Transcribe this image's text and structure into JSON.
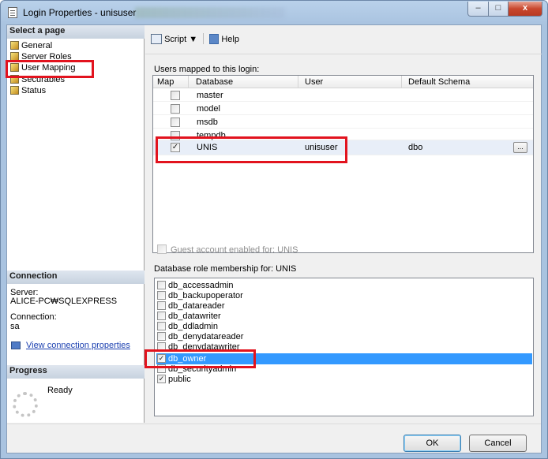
{
  "window": {
    "title": "Login Properties - unisuser"
  },
  "left": {
    "select_page_header": "Select a page",
    "pages": [
      "General",
      "Server Roles",
      "User Mapping",
      "Securables",
      "Status"
    ],
    "connection_header": "Connection",
    "server_label": "Server:",
    "server_value": "ALICE-PC₩SQLEXPRESS",
    "connection_label": "Connection:",
    "connection_value": "sa",
    "view_connection_link": "View connection properties",
    "progress_header": "Progress",
    "progress_status": "Ready"
  },
  "toolbar": {
    "script_label": "Script",
    "help_label": "Help"
  },
  "mapping": {
    "label": "Users mapped to this login:",
    "columns": [
      "Map",
      "Database",
      "User",
      "Default Schema"
    ],
    "rows": [
      {
        "checked": false,
        "database": "master",
        "user": "",
        "schema": ""
      },
      {
        "checked": false,
        "database": "model",
        "user": "",
        "schema": ""
      },
      {
        "checked": false,
        "database": "msdb",
        "user": "",
        "schema": ""
      },
      {
        "checked": false,
        "database": "tempdb",
        "user": "",
        "schema": ""
      },
      {
        "checked": true,
        "database": "UNIS",
        "user": "unisuser",
        "schema": "dbo"
      }
    ],
    "ellipsis": "..."
  },
  "guest_label": "Guest account enabled for: UNIS",
  "roles": {
    "label": "Database role membership for: UNIS",
    "items": [
      {
        "name": "db_accessadmin",
        "checked": false
      },
      {
        "name": "db_backupoperator",
        "checked": false
      },
      {
        "name": "db_datareader",
        "checked": false
      },
      {
        "name": "db_datawriter",
        "checked": false
      },
      {
        "name": "db_ddladmin",
        "checked": false
      },
      {
        "name": "db_denydatareader",
        "checked": false
      },
      {
        "name": "db_denydatawriter",
        "checked": false
      },
      {
        "name": "db_owner",
        "checked": true
      },
      {
        "name": "db_securityadmin",
        "checked": false
      },
      {
        "name": "public",
        "checked": true
      }
    ]
  },
  "buttons": {
    "ok": "OK",
    "cancel": "Cancel"
  },
  "window_buttons": {
    "minimize": "–",
    "maximize": "□",
    "close": "x"
  },
  "colors": {
    "highlight": "#e2131e",
    "selection": "#3399ff"
  }
}
